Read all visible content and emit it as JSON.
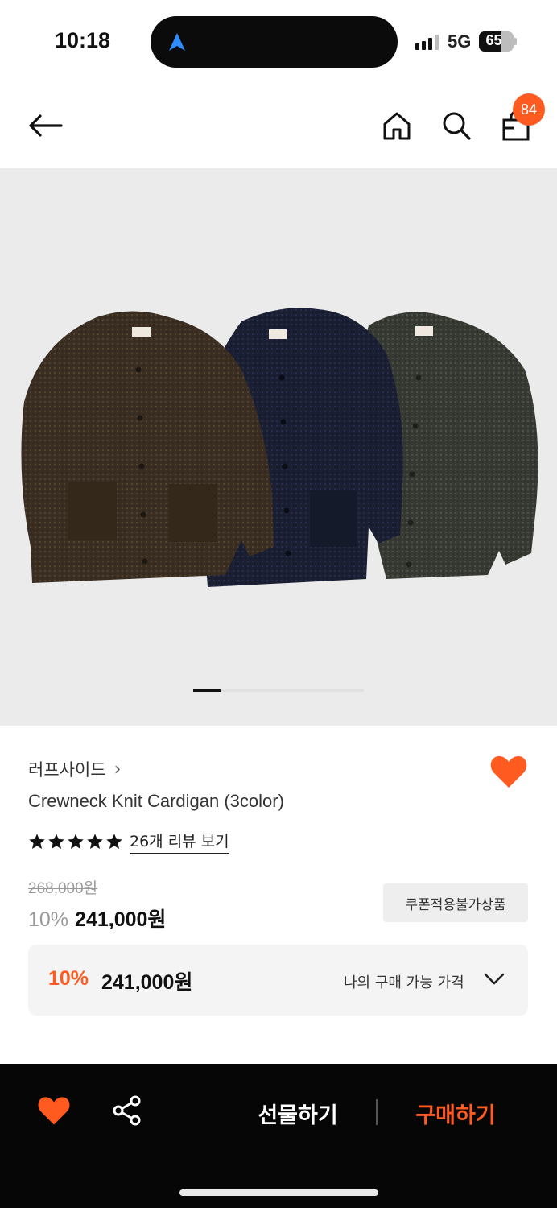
{
  "status_bar": {
    "time": "10:18",
    "network": "5G",
    "battery": "65",
    "battery_level": 0.65
  },
  "nav": {
    "back_icon": "arrow-left-icon",
    "home_icon": "home-icon",
    "search_icon": "search-icon",
    "cart_icon": "shopping-bag-icon",
    "cart_count": "84"
  },
  "carousel": {
    "current_index": 1,
    "total": 6
  },
  "product": {
    "brand": "러프사이드",
    "brand_chevron": "›",
    "name": "Crewneck Knit Cardigan (3color)",
    "rating_stars": 5,
    "reviews_link": "26개 리뷰 보기",
    "wishlisted": true,
    "original_price": "268,000원",
    "discount_percent": "10%",
    "sale_price": "241,000원",
    "coupon_badge": "쿠폰적용불가상품",
    "my_price": {
      "discount_percent": "10%",
      "price": "241,000원",
      "label": "나의 구매 가능 가격"
    }
  },
  "bottom_bar": {
    "gift_label": "선물하기",
    "buy_label": "구매하기"
  },
  "colors": {
    "accent": "#ff5a1f",
    "bottom_bar_bg": "#060606",
    "hero_bg": "#ebebeb",
    "cardigan_brown": "#3a2e22",
    "cardigan_navy": "#1a1f33",
    "cardigan_green": "#363a33"
  }
}
